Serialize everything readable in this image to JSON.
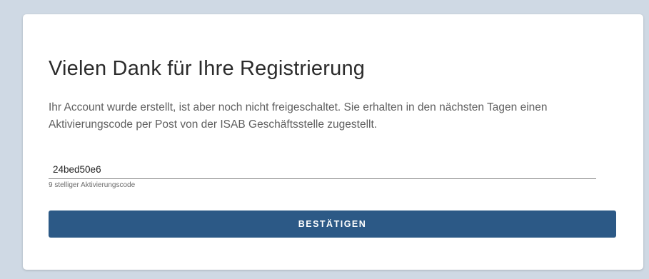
{
  "card": {
    "title": "Vielen Dank für Ihre Registrierung",
    "message": "Ihr Account wurde erstellt, ist aber noch nicht freigeschaltet. Sie erhalten in den nächsten Tagen einen Aktivierungscode per Post von der ISAB Geschäftsstelle zugestellt.",
    "activation_field": {
      "value": "24bed50e6",
      "helper": "9 stelliger Aktivierungscode"
    },
    "confirm_label": "BESTÄTIGEN"
  },
  "colors": {
    "page_background": "#cfd9e4",
    "card_background": "#ffffff",
    "button_background": "#2c5986",
    "button_text": "#ffffff"
  }
}
